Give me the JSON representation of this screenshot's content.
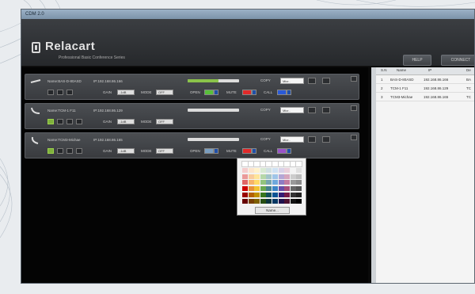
{
  "window": {
    "title": "CDM 2.0"
  },
  "header": {
    "brand": "Relacart",
    "tagline": "Professional Basic Conference Series",
    "buttons": [
      {
        "label": "HELP"
      },
      {
        "label": "CONNECT"
      }
    ]
  },
  "devices": [
    {
      "name": "Name:BAS-D-80ASD",
      "ip": "IP:192.168.86.166",
      "level": 0.6,
      "copy_label": "COPY",
      "copy_value": "Micr..",
      "gain_label": "GAIN",
      "gain_value": "-1dB",
      "mode_label": "MODE",
      "mode_value": "OFF",
      "open_label": "OPEN",
      "open_color": "#58c03a",
      "mute_label": "MUTE",
      "mute_color": "#e02a2a",
      "call_label": "CALL",
      "call_color": "#2a5ad8"
    },
    {
      "name": "Name:TCM-1 F11",
      "ip": "IP:192.168.86.129",
      "level": 0.0,
      "copy_label": "COPY",
      "copy_value": "Micr..",
      "gain_label": "GAIN",
      "gain_value": "-1dB",
      "mode_label": "MODE",
      "mode_value": "OFF"
    },
    {
      "name": "Name:TCM3-Michae",
      "ip": "IP:192.168.86.165",
      "level": 0.0,
      "copy_label": "COPY",
      "copy_value": "Micr..",
      "gain_label": "GAIN",
      "gain_value": "-1dB",
      "mode_label": "MODE",
      "mode_value": "OFF",
      "open_label": "OPEN",
      "open_color": "#7a9ec0",
      "mute_label": "MUTE",
      "mute_color": "#e02a2a",
      "call_label": "CALL",
      "call_color": "#9a52c8"
    }
  ],
  "palette": {
    "more_label": "Name...",
    "colors": [
      [
        "#ffffff",
        "#ffffff",
        "#ffffff",
        "#ffffff",
        "#ffffff",
        "#ffffff",
        "#ffffff",
        "#ffffff",
        "#ffffff",
        "#ffffff"
      ],
      [
        "#f4cccc",
        "#fce5cd",
        "#fff2cc",
        "#d9ead3",
        "#d0e0e3",
        "#cfe2f3",
        "#d9d2e9",
        "#ead1dc",
        "#f4f4f4",
        "#e0e0e0"
      ],
      [
        "#ea9999",
        "#f9cb9c",
        "#ffe599",
        "#b6d7a8",
        "#a2c4c9",
        "#9fc5e8",
        "#b4a7d6",
        "#d5a6bd",
        "#cccccc",
        "#bdbdbd"
      ],
      [
        "#e06666",
        "#f6b26b",
        "#ffd966",
        "#93c47d",
        "#76a5af",
        "#6fa8dc",
        "#8e7cc3",
        "#c27ba0",
        "#999999",
        "#8a8a8a"
      ],
      [
        "#cc0000",
        "#e69138",
        "#f1c232",
        "#6aa84f",
        "#45818e",
        "#3d85c6",
        "#674ea7",
        "#a64d79",
        "#666666",
        "#555555"
      ],
      [
        "#990000",
        "#b45f06",
        "#bf9000",
        "#38761d",
        "#134f5c",
        "#0b5394",
        "#351c75",
        "#741b47",
        "#333333",
        "#222222"
      ],
      [
        "#660000",
        "#783f04",
        "#7f6000",
        "#274e13",
        "#0c343d",
        "#073763",
        "#20124d",
        "#4c1130",
        "#111111",
        "#000000"
      ]
    ]
  },
  "grid": {
    "headers": [
      "S.N",
      "Name",
      "IP",
      "De"
    ],
    "rows": [
      [
        "1",
        "BAS-D-80ASD",
        "192.168.86.166",
        "BA"
      ],
      [
        "2",
        "TCM-1 F11",
        "192.168.86.129",
        "TC"
      ],
      [
        "3",
        "TCM3-Michae",
        "192.168.86.165",
        "TC"
      ]
    ]
  }
}
